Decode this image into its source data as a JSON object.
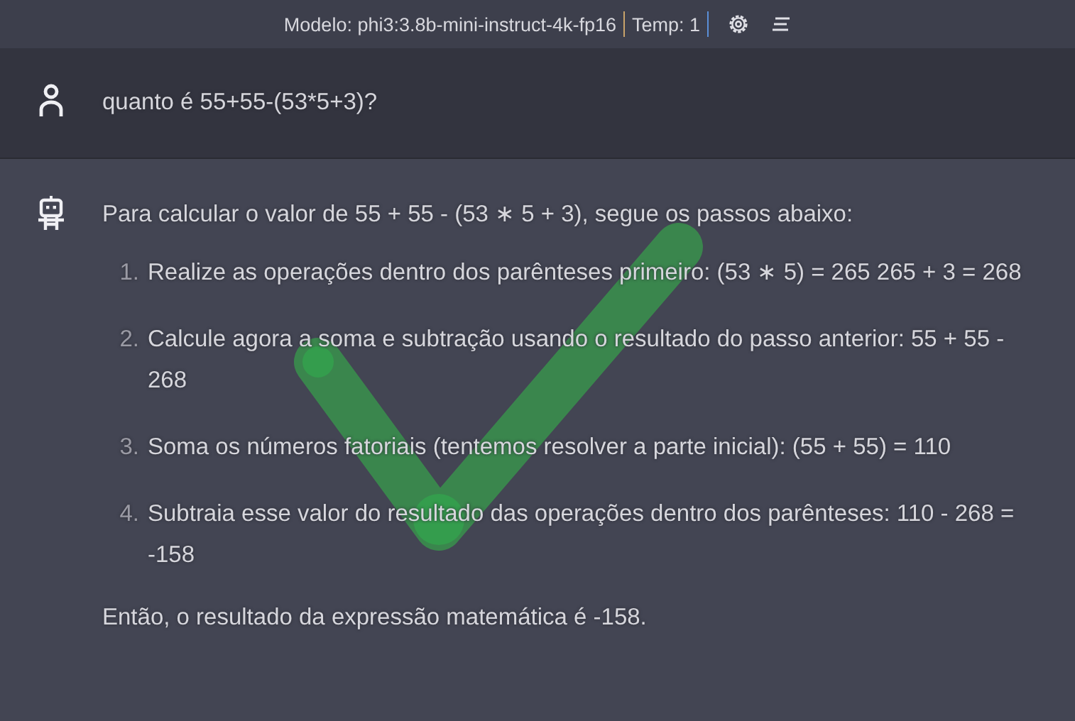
{
  "header": {
    "model": "Modelo: phi3:3.8b-mini-instruct-4k-fp16",
    "temp": "Temp: 1"
  },
  "messages": [
    {
      "kind": "user",
      "text": "quanto é 55+55-(53*5+3)?"
    },
    {
      "kind": "assistant",
      "intro": "Para calcular o valor de 55 + 55 - (53 ∗ 5 + 3), segue os passos abaixo:",
      "steps": [
        {
          "number": "1.",
          "text": "Realize as operações dentro dos parênteses primeiro: (53 ∗ 5) = 265 265 + 3 = 268"
        },
        {
          "number": "2.",
          "text": "Calcule agora a soma e subtração usando o resultado do passo anterior: 55 + 55 - 268"
        },
        {
          "number": "3.",
          "text": "Soma os números fatoriais (tentemos resolver a parte inicial): (55 + 55) = 110"
        },
        {
          "number": "4.",
          "text": "Subtraia esse valor do resultado das operações dentro dos parênteses: 110 - 268 = -158"
        }
      ],
      "outro": "Então, o resultado da expressão matemática é -158."
    }
  ],
  "annotation": {
    "kind": "checkmark"
  }
}
